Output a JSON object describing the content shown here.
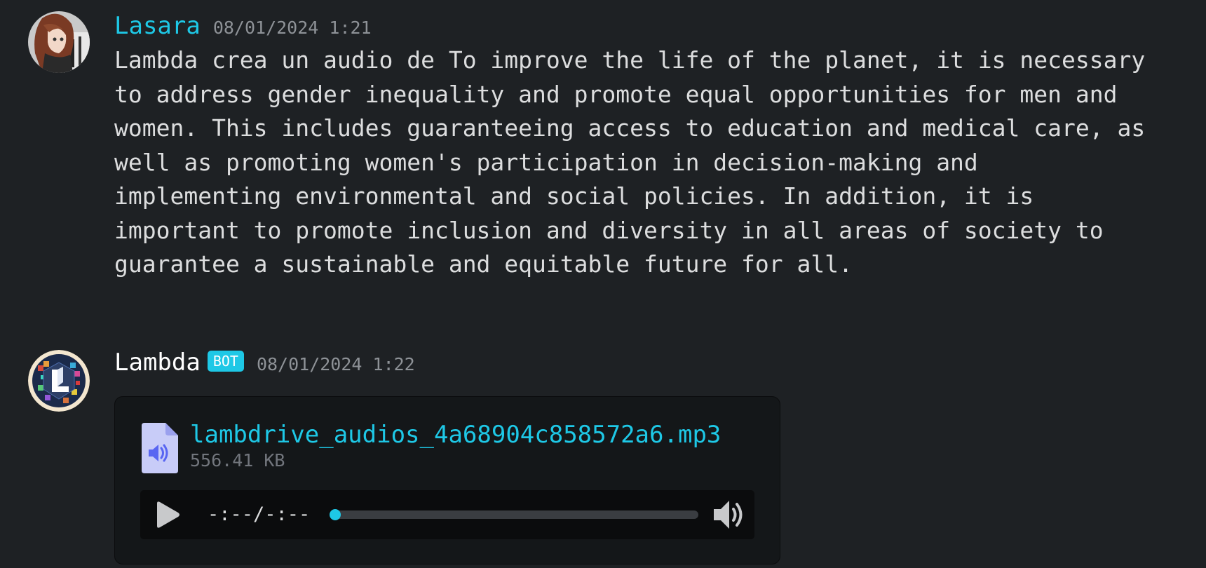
{
  "messages": [
    {
      "author": "Lasara",
      "author_color": "#1ec8e6",
      "timestamp": "08/01/2024 1:21",
      "avatar": "user-avatar",
      "content": "Lambda crea un audio de To improve the life of the planet, it is necessary to address gender inequality and promote equal opportunities for men and women. This includes guaranteeing access to education and medical care, as well as promoting women's participation in decision-making and implementing environmental and social policies. In addition, it is important to promote inclusion and diversity in all areas of society to guarantee a sustainable and equitable future for all."
    },
    {
      "author": "Lambda",
      "author_color": "#ffffff",
      "badge": "BOT",
      "badge_color": "#1ec8e6",
      "timestamp": "08/01/2024 1:22",
      "avatar": "bot-avatar",
      "attachment": {
        "icon": "audio-file-icon",
        "filename": "lambdrive_audios_4a68904c858572a6.mp3",
        "size": "556.41 KB",
        "player": {
          "time": "-:--/-:--",
          "progress": 0,
          "play_icon": "play-icon",
          "volume_icon": "volume-icon"
        }
      }
    }
  ]
}
